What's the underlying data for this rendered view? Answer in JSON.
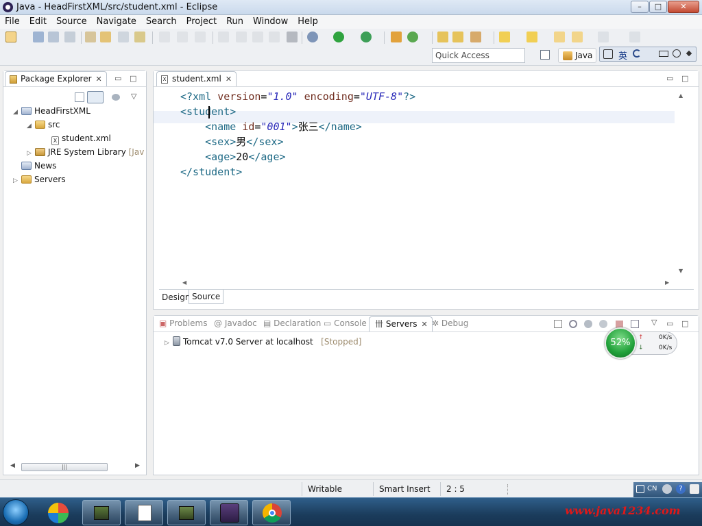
{
  "window": {
    "title": "Java - HeadFirstXML/src/student.xml - Eclipse",
    "min": "–",
    "max": "□",
    "close": "✕"
  },
  "menu": [
    "File",
    "Edit",
    "Source",
    "Navigate",
    "Search",
    "Project",
    "Run",
    "Window",
    "Help"
  ],
  "toolbar": {
    "quick_access_placeholder": "Quick Access",
    "perspective": "Java",
    "ime_label": "英"
  },
  "package_explorer": {
    "tab": "Package Explorer",
    "tree": [
      {
        "label": "HeadFirstXML"
      },
      {
        "label": "src"
      },
      {
        "label": "student.xml"
      },
      {
        "label": "JRE System Library",
        "suffix": "[Jav"
      },
      {
        "label": "News"
      },
      {
        "label": "Servers"
      }
    ]
  },
  "editor": {
    "tab": "student.xml",
    "code": {
      "l1": {
        "open": "<?xml ",
        "k1": "version",
        "eq1": "=",
        "v1": "\"1.0\"",
        "k2": " encoding",
        "eq2": "=",
        "v2": "\"UTF-8\"",
        "close": "?>"
      },
      "l2": {
        "open": "<student>"
      },
      "l3": {
        "open": "<name ",
        "k": "id",
        "eq": "=",
        "v": "\"001\"",
        "gt": ">",
        "text": "张三",
        "close": "</name>"
      },
      "l4": {
        "open": "<sex>",
        "text": "男",
        "close": "</sex>"
      },
      "l5": {
        "open": "<age>",
        "text": "20",
        "close": "</age>"
      },
      "l6": {
        "close": "</student>"
      }
    },
    "bottom_tabs": [
      "Design",
      "Source"
    ]
  },
  "bottom_panel": {
    "tabs": [
      "Problems",
      "Javadoc",
      "Declaration",
      "Console",
      "Servers",
      "Debug"
    ],
    "server": {
      "name": "Tomcat v7.0 Server at localhost",
      "state": "[Stopped]"
    }
  },
  "net_meter": {
    "percent": "52%",
    "up": "0K/s",
    "down": "0K/s"
  },
  "status": {
    "writable": "Writable",
    "insert": "Smart Insert",
    "position": "2 : 5"
  },
  "tray": {
    "lang": "CN"
  },
  "watermark": "www.java1234.com",
  "colors": {
    "accent": "#1f6a86",
    "attr_value": "#2828b8"
  }
}
